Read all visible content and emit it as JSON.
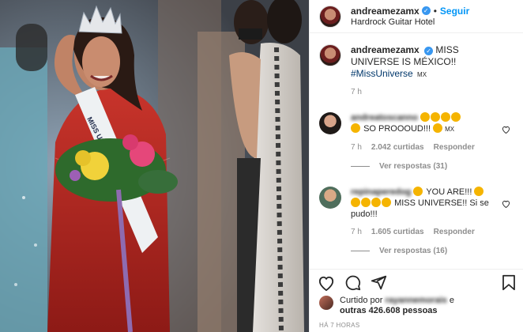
{
  "post": {
    "username": "andreamezamx",
    "follow_label": "Seguir",
    "location": "Hardrock Guitar Hotel"
  },
  "caption": {
    "username": "andreamezamx",
    "text": "MISS UNIVERSE IS MÉXICO!!",
    "hashtag": "#MissUniverse",
    "flag_text": "MX",
    "time": "7 h"
  },
  "comments": [
    {
      "username": "andreatoscanno",
      "text": "SO PROOOUD!!!",
      "flag": "MX",
      "time": "7 h",
      "likes": "2.042 curtidas",
      "reply_label": "Responder",
      "view_replies": "Ver respostas (31)"
    },
    {
      "username": "repinaperedog",
      "text": "YOU ARE!!!",
      "text_2": "MISS UNIVERSE!! Si se pudo!!!",
      "time": "7 h",
      "likes": "1.605 curtidas",
      "reply_label": "Responder",
      "view_replies": "Ver respostas (16)"
    }
  ],
  "likes_summary": {
    "prefix": "Curtido por",
    "user": "rayannemorais",
    "suffix": "e",
    "line2": "outras 426.608 pessoas"
  },
  "posted_ago": "HÁ 7 HORAS",
  "colors": {
    "accent": "#0095f6",
    "muted": "#8e8e8e",
    "verified": "#3897f0",
    "dress": "#b3241f"
  }
}
